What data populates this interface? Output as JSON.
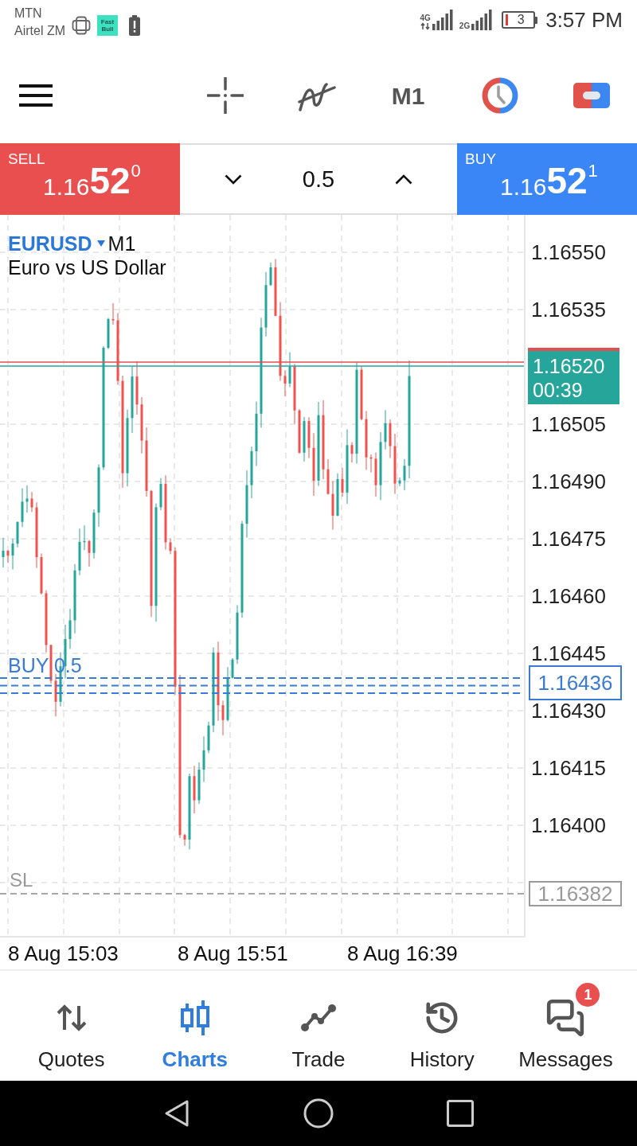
{
  "status_bar": {
    "carriers": [
      "MTN",
      "Airtel ZM"
    ],
    "app_icon_label": "Fast Bull",
    "networks": [
      {
        "type": "4G"
      },
      {
        "type": "2G"
      }
    ],
    "battery": "3",
    "time": "3:57 PM"
  },
  "toolbar": {
    "timeframe": "M1",
    "trade_panel_toggle": {
      "on": true
    }
  },
  "trade_panel": {
    "sell": {
      "label": "SELL",
      "price": {
        "prefix": "1.16",
        "main": "52",
        "fraction": "0"
      }
    },
    "volume": "0.5",
    "buy": {
      "label": "BUY",
      "price": {
        "prefix": "1.16",
        "main": "52",
        "fraction": "1"
      }
    }
  },
  "chart": {
    "symbol": "EURUSD",
    "timeframe": "M1",
    "description": "Euro vs US Dollar",
    "price_axis": [
      {
        "kind": "tick",
        "label": "1.16550"
      },
      {
        "kind": "tick",
        "label": "1.16535"
      },
      {
        "kind": "current",
        "value": "1.16520",
        "countdown": "00:39"
      },
      {
        "kind": "tick",
        "label": "1.16505"
      },
      {
        "kind": "tick",
        "label": "1.16490"
      },
      {
        "kind": "tick",
        "label": "1.16475"
      },
      {
        "kind": "tick",
        "label": "1.16460"
      },
      {
        "kind": "tick",
        "label": "1.16445"
      },
      {
        "kind": "tick",
        "label": "1.16430"
      },
      {
        "kind": "tick",
        "label": "1.16415"
      },
      {
        "kind": "tick",
        "label": "1.16400"
      }
    ],
    "order_label": "BUY 0.5",
    "order_price": "1.16436",
    "stop_loss": {
      "label": "SL",
      "price": "1.16382"
    },
    "time_axis": [
      "8 Aug 15:03",
      "8 Aug 15:51",
      "8 Aug 16:39"
    ]
  },
  "bottom_nav": [
    {
      "label": "Quotes",
      "selected": false
    },
    {
      "label": "Charts",
      "selected": true
    },
    {
      "label": "Trade",
      "selected": false
    },
    {
      "label": "History",
      "selected": false
    },
    {
      "label": "Messages",
      "selected": false,
      "badge": "1"
    }
  ]
}
